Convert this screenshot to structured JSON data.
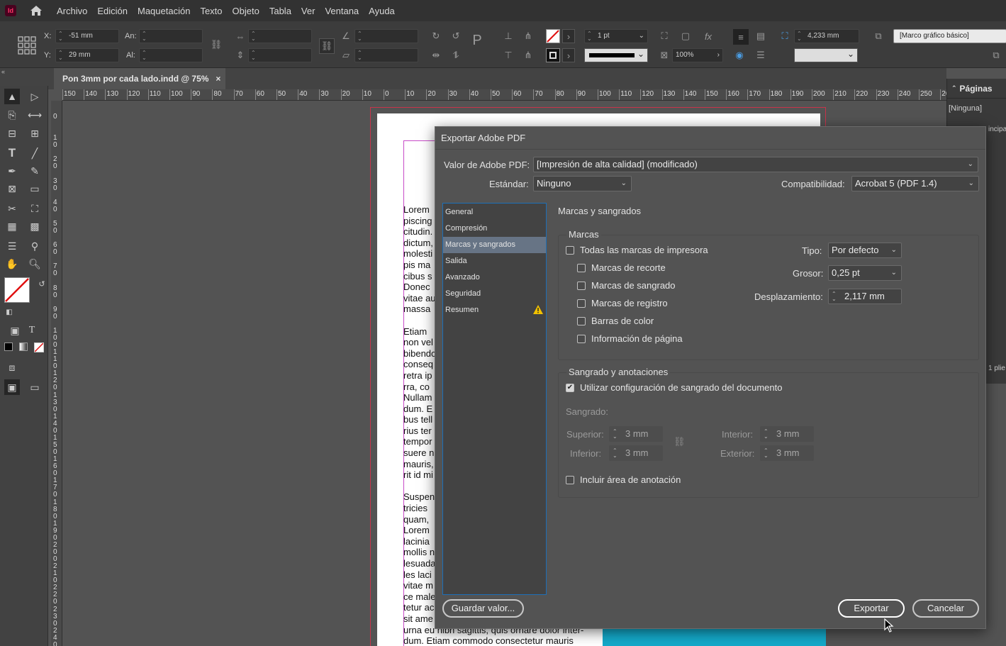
{
  "app": {
    "icon_text": "Id",
    "menu": [
      "Archivo",
      "Edición",
      "Maquetación",
      "Texto",
      "Objeto",
      "Tabla",
      "Ver",
      "Ventana",
      "Ayuda"
    ]
  },
  "control": {
    "x_label": "X:",
    "x_value": "-51 mm",
    "y_label": "Y:",
    "y_value": "29 mm",
    "w_label": "An:",
    "w_value": "",
    "h_label": "Al:",
    "h_value": "",
    "stroke_weight": "1 pt",
    "scale": "100%",
    "gap": "4,233 mm",
    "object_style": "[Marco gráfico básico]"
  },
  "document": {
    "tab_title": "Pon 3mm por cada lado.indd @ 75%",
    "close_glyph": "×",
    "ruler_h": [
      "150",
      "140",
      "130",
      "120",
      "110",
      "100",
      "90",
      "80",
      "70",
      "60",
      "50",
      "40",
      "30",
      "20",
      "10",
      "0",
      "10",
      "20",
      "30",
      "40",
      "50",
      "60",
      "70",
      "80",
      "90",
      "100",
      "110",
      "120",
      "130",
      "140",
      "150",
      "160",
      "170",
      "180",
      "190",
      "200",
      "210",
      "220",
      "230",
      "240",
      "250",
      "260"
    ],
    "ruler_v": [
      "0",
      "10",
      "20",
      "30",
      "40",
      "50",
      "60",
      "70",
      "80",
      "90",
      "100",
      "110",
      "120",
      "130",
      "140",
      "150",
      "160",
      "170",
      "180",
      "190",
      "200",
      "210",
      "220",
      "230",
      "240",
      "250"
    ],
    "text_lines": [
      "Lorem",
      "piscing",
      "citudin.",
      "dictum,",
      "molesti",
      "pis ma",
      "cibus s",
      "Donec",
      "vitae au",
      "massa",
      "",
      "Etiam",
      "non vel",
      "bibendo",
      "conseq",
      "retra ip",
      "rra, co",
      "Nullam",
      "dum. E",
      "bus tell",
      "rius ter",
      "tempor",
      "suere n",
      "mauris,",
      "rit id mi",
      "",
      "Suspen",
      "tricies",
      "quam,",
      "Lorem",
      "lacinia",
      "mollis n",
      "lesuada",
      "les laci",
      "vitae m",
      "ce male",
      "tetur ac",
      "sit ame",
      "urna eu nibh sagittis, quis ornare dolor inter-",
      "dum. Etiam commodo consectetur mauris"
    ]
  },
  "pages_panel": {
    "title": "Páginas",
    "none_label": "[Ninguna]",
    "partial_master": "incipal",
    "partial_spread": "1 plie"
  },
  "dialog": {
    "title": "Exportar Adobe PDF",
    "preset_label": "Valor de Adobe PDF:",
    "preset_value": "[Impresión de alta calidad] (modificado)",
    "standard_label": "Estándar:",
    "standard_value": "Ninguno",
    "compat_label": "Compatibilidad:",
    "compat_value": "Acrobat 5 (PDF 1.4)",
    "sections": [
      "General",
      "Compresión",
      "Marcas y sangrados",
      "Salida",
      "Avanzado",
      "Seguridad",
      "Resumen"
    ],
    "active_section": "Marcas y sangrados",
    "section_title": "Marcas y sangrados",
    "marks_group": "Marcas",
    "all_marks": "Todas las marcas de impresora",
    "crop_marks": "Marcas de recorte",
    "bleed_marks": "Marcas de sangrado",
    "reg_marks": "Marcas de registro",
    "color_bars": "Barras de color",
    "page_info": "Información de página",
    "type_label": "Tipo:",
    "type_value": "Por defecto",
    "weight_label": "Grosor:",
    "weight_value": "0,25 pt",
    "offset_label": "Desplazamiento:",
    "offset_value": "2,117 mm",
    "bleed_group": "Sangrado y anotaciones",
    "use_doc_bleed": "Utilizar configuración de sangrado del documento",
    "bleed_label": "Sangrado:",
    "top_label": "Superior:",
    "top_value": "3 mm",
    "bottom_label": "Inferior:",
    "bottom_value": "3 mm",
    "inside_label": "Interior:",
    "inside_value": "3 mm",
    "outside_label": "Exterior:",
    "outside_value": "3 mm",
    "slug": "Incluir área de anotación",
    "save_preset": "Guardar valor...",
    "export": "Exportar",
    "cancel": "Cancelar"
  }
}
